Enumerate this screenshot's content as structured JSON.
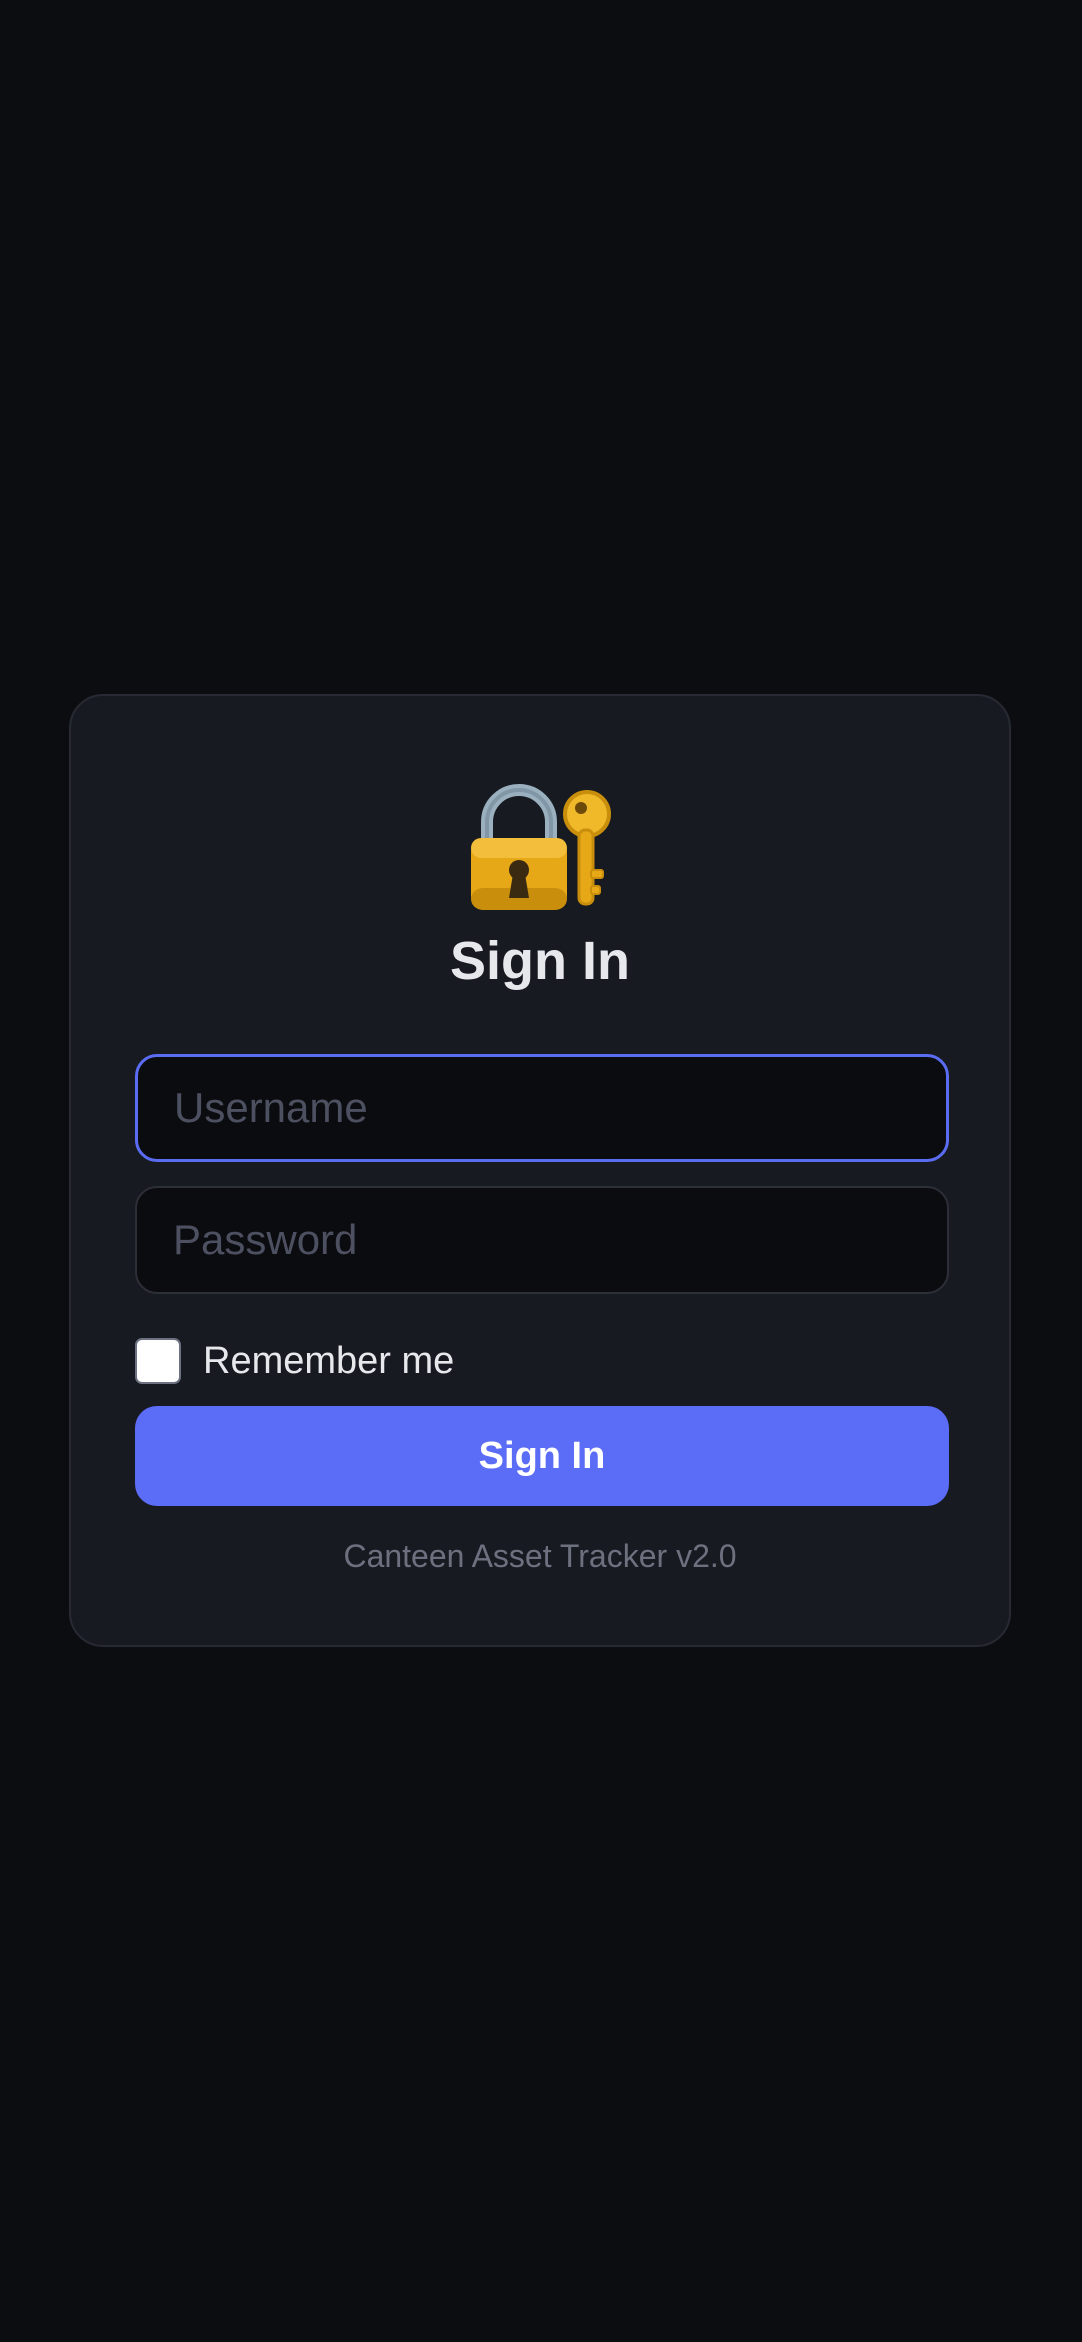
{
  "login": {
    "icon": "locked-with-key-icon",
    "title": "Sign In",
    "username": {
      "placeholder": "Username",
      "value": "",
      "focused": true
    },
    "password": {
      "placeholder": "Password",
      "value": ""
    },
    "remember": {
      "label": "Remember me",
      "checked": false
    },
    "submit_label": "Sign In",
    "footer": "Canteen Asset Tracker v2.0"
  },
  "colors": {
    "background": "#0b0d10",
    "card": "#171a21",
    "accent": "#5b6cf6",
    "focus_border": "#5a6cf1",
    "text": "#e6e8ec",
    "muted_text": "#6d717f"
  }
}
